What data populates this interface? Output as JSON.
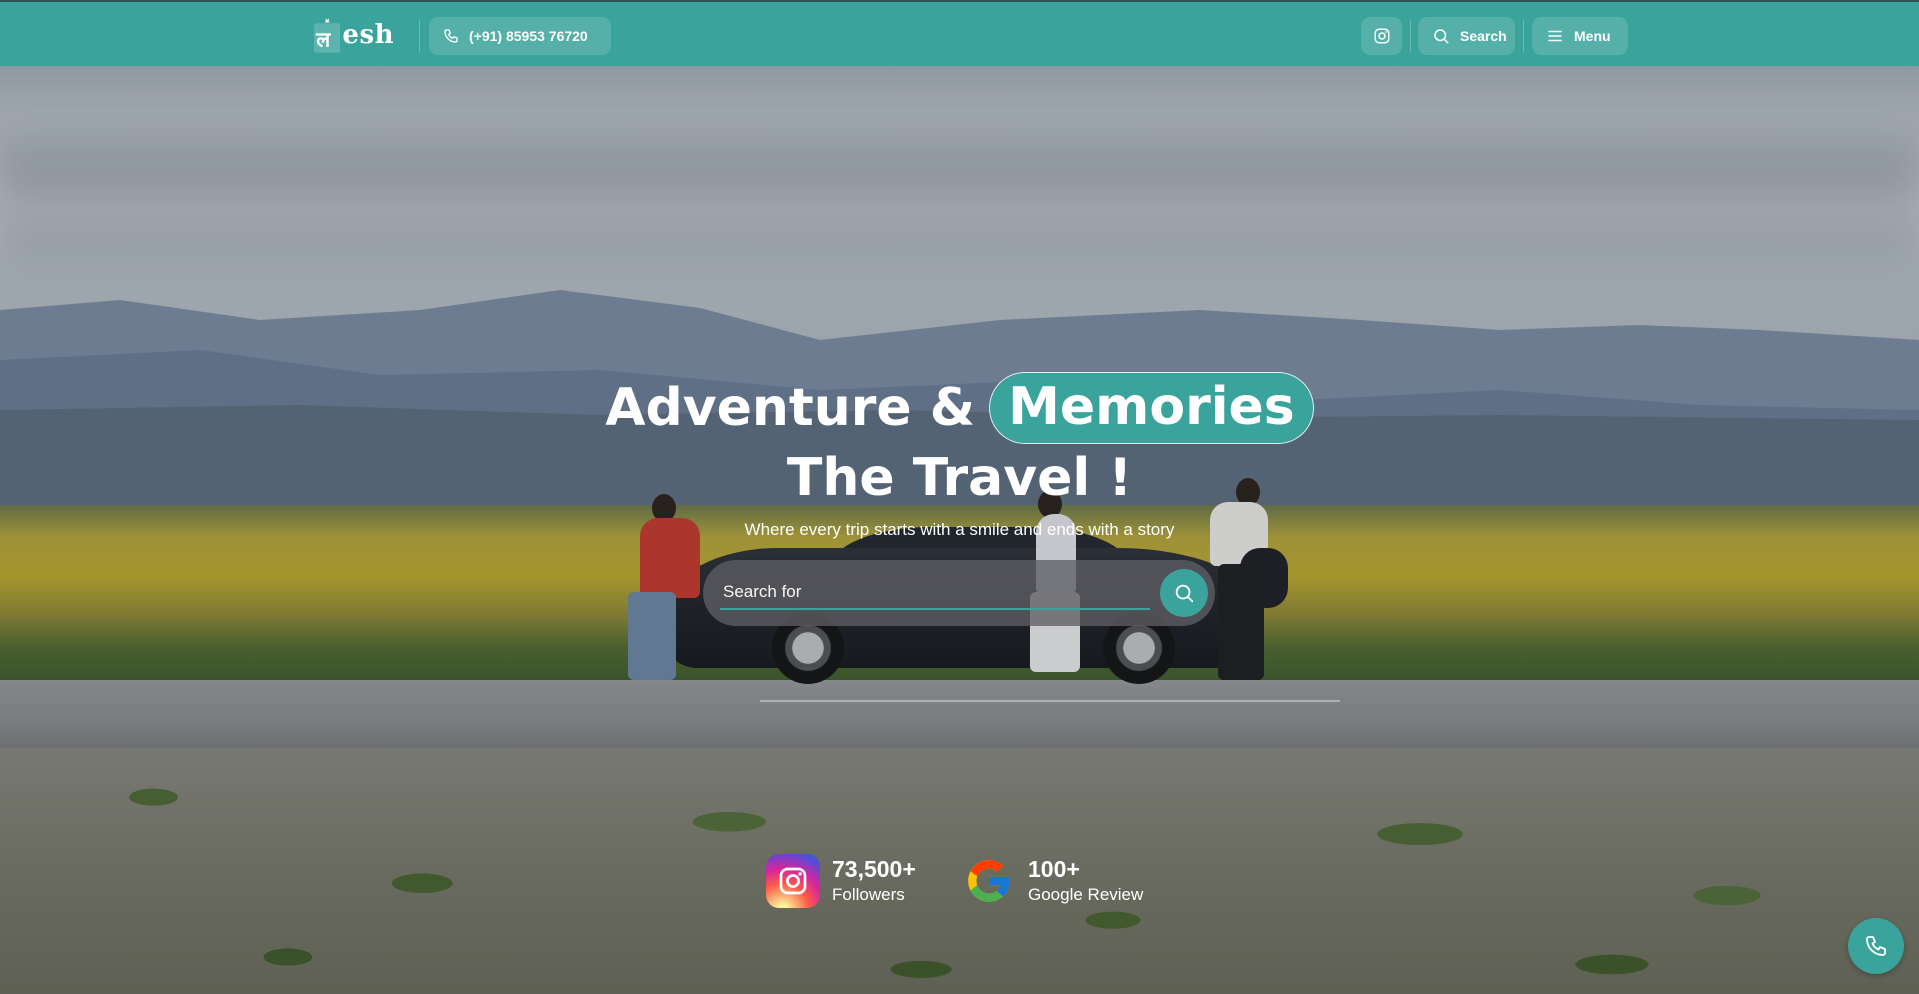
{
  "brand": {
    "logo_text": "esh"
  },
  "header": {
    "phone": "(+91) 85953 76720",
    "search_label": "Search",
    "menu_label": "Menu"
  },
  "hero": {
    "title_part1": "Adventure &",
    "title_highlight": "Memories",
    "title_line2": "The Travel !",
    "subtitle": "Where every trip starts with a smile and ends with a story",
    "search_placeholder": "Search for"
  },
  "stats": [
    {
      "number": "73,500+",
      "label": "Followers",
      "icon": "instagram-icon"
    },
    {
      "number": "100+",
      "label": "Google Review",
      "icon": "google-icon"
    }
  ],
  "colors": {
    "accent": "#3aa39b",
    "header_bg": "#3aa39b",
    "text": "#ffffff"
  }
}
